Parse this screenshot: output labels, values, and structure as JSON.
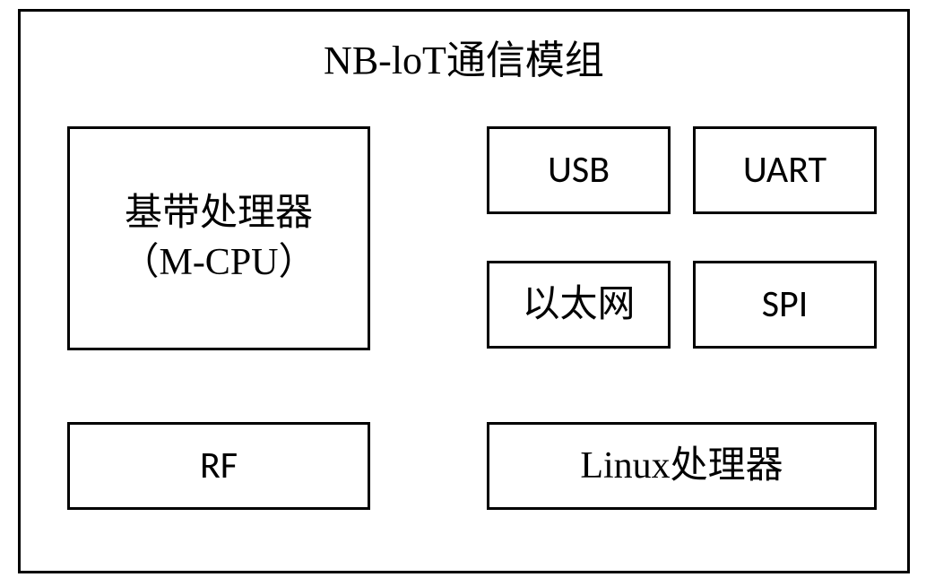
{
  "diagram": {
    "title": "NB-loT通信模组",
    "boxes": {
      "cpu": "基带处理器\n（M-CPU）",
      "usb": "USB",
      "uart": "UART",
      "ethernet": "以太网",
      "spi": "SPI",
      "rf": "RF",
      "linux": "Linux处理器"
    }
  }
}
